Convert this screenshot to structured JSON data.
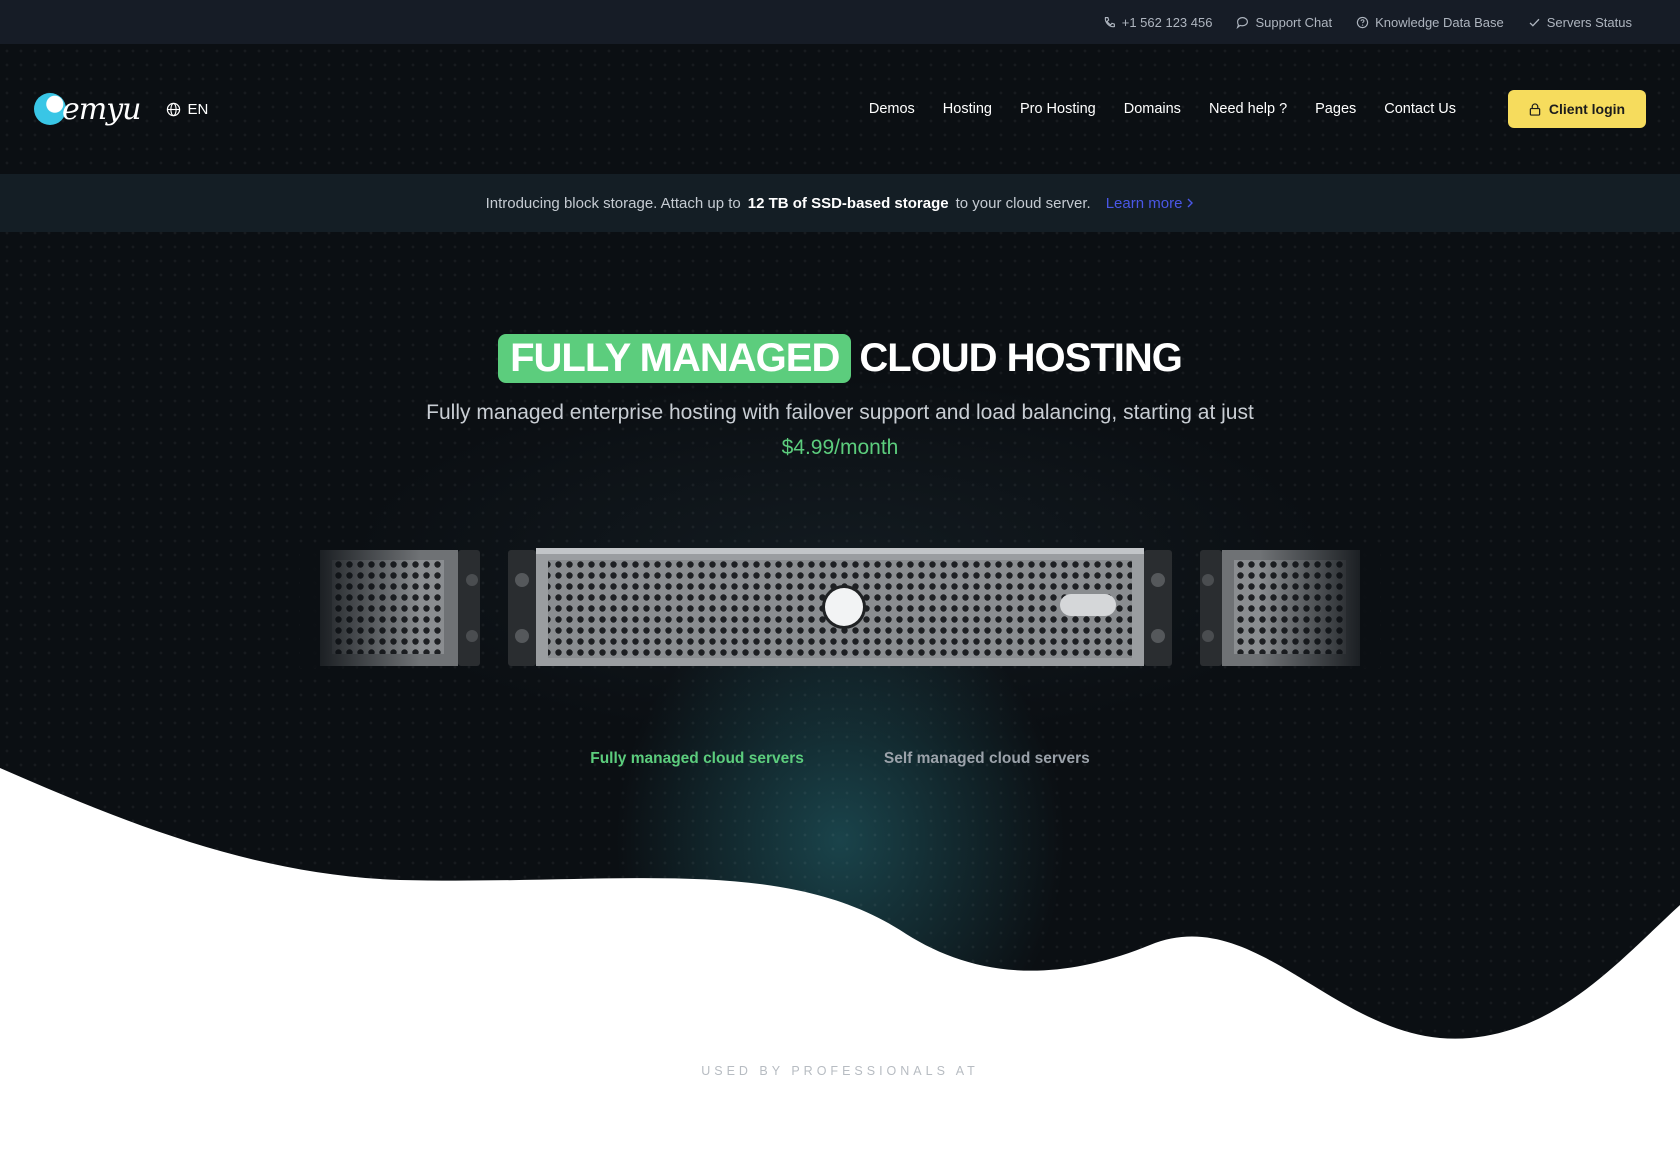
{
  "topbar": {
    "phone": "+1 562 123 456",
    "support_chat": "Support Chat",
    "knowledge_base": "Knowledge Data Base",
    "servers_status": "Servers Status"
  },
  "header": {
    "logo_text": "emyu",
    "language": "EN",
    "nav": [
      "Demos",
      "Hosting",
      "Pro Hosting",
      "Domains",
      "Need help ?",
      "Pages",
      "Contact Us"
    ],
    "login_label": "Client login"
  },
  "announcement": {
    "text_before": "Introducing block storage. Attach up to",
    "text_bold": "12 TB of SSD-based storage",
    "text_after": "to your cloud server.",
    "link": "Learn more"
  },
  "hero": {
    "title_highlight": "FULLY MANAGED",
    "title_rest": "CLOUD HOSTING",
    "subtitle": "Fully managed enterprise hosting with failover support and load balancing, starting at just",
    "price": "$4.99/month"
  },
  "tabs": {
    "active": "Fully managed cloud servers",
    "inactive": "Self managed cloud servers"
  },
  "footer_label": "USED BY PROFESSIONALS AT",
  "colors": {
    "accent_green": "#5ccd7d",
    "login_yellow": "#f6dc5d",
    "link_blue": "#4a57e6",
    "background_dark": "#0b0f13"
  }
}
